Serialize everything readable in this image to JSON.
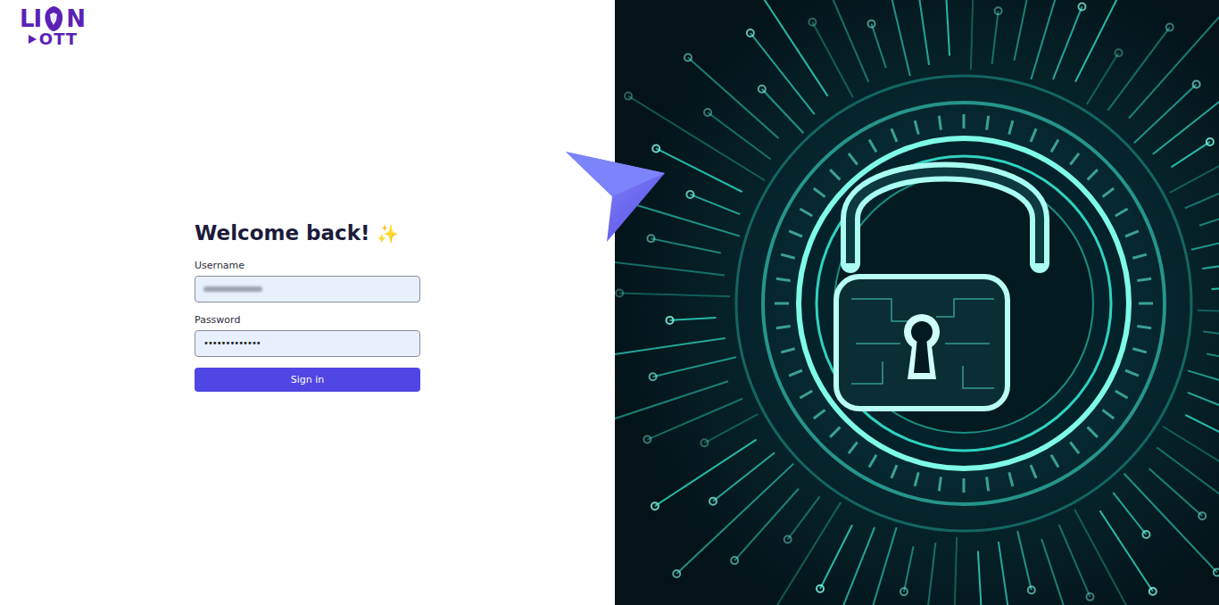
{
  "logo": {
    "left": "LI",
    "right": "N",
    "bottom": "OTT"
  },
  "form": {
    "title": "Welcome back!",
    "title_icon": "✨",
    "username": {
      "label": "Username",
      "blurred": true
    },
    "password": {
      "label": "Password",
      "value": "•••••••••••••"
    },
    "submit": "Sign in"
  }
}
